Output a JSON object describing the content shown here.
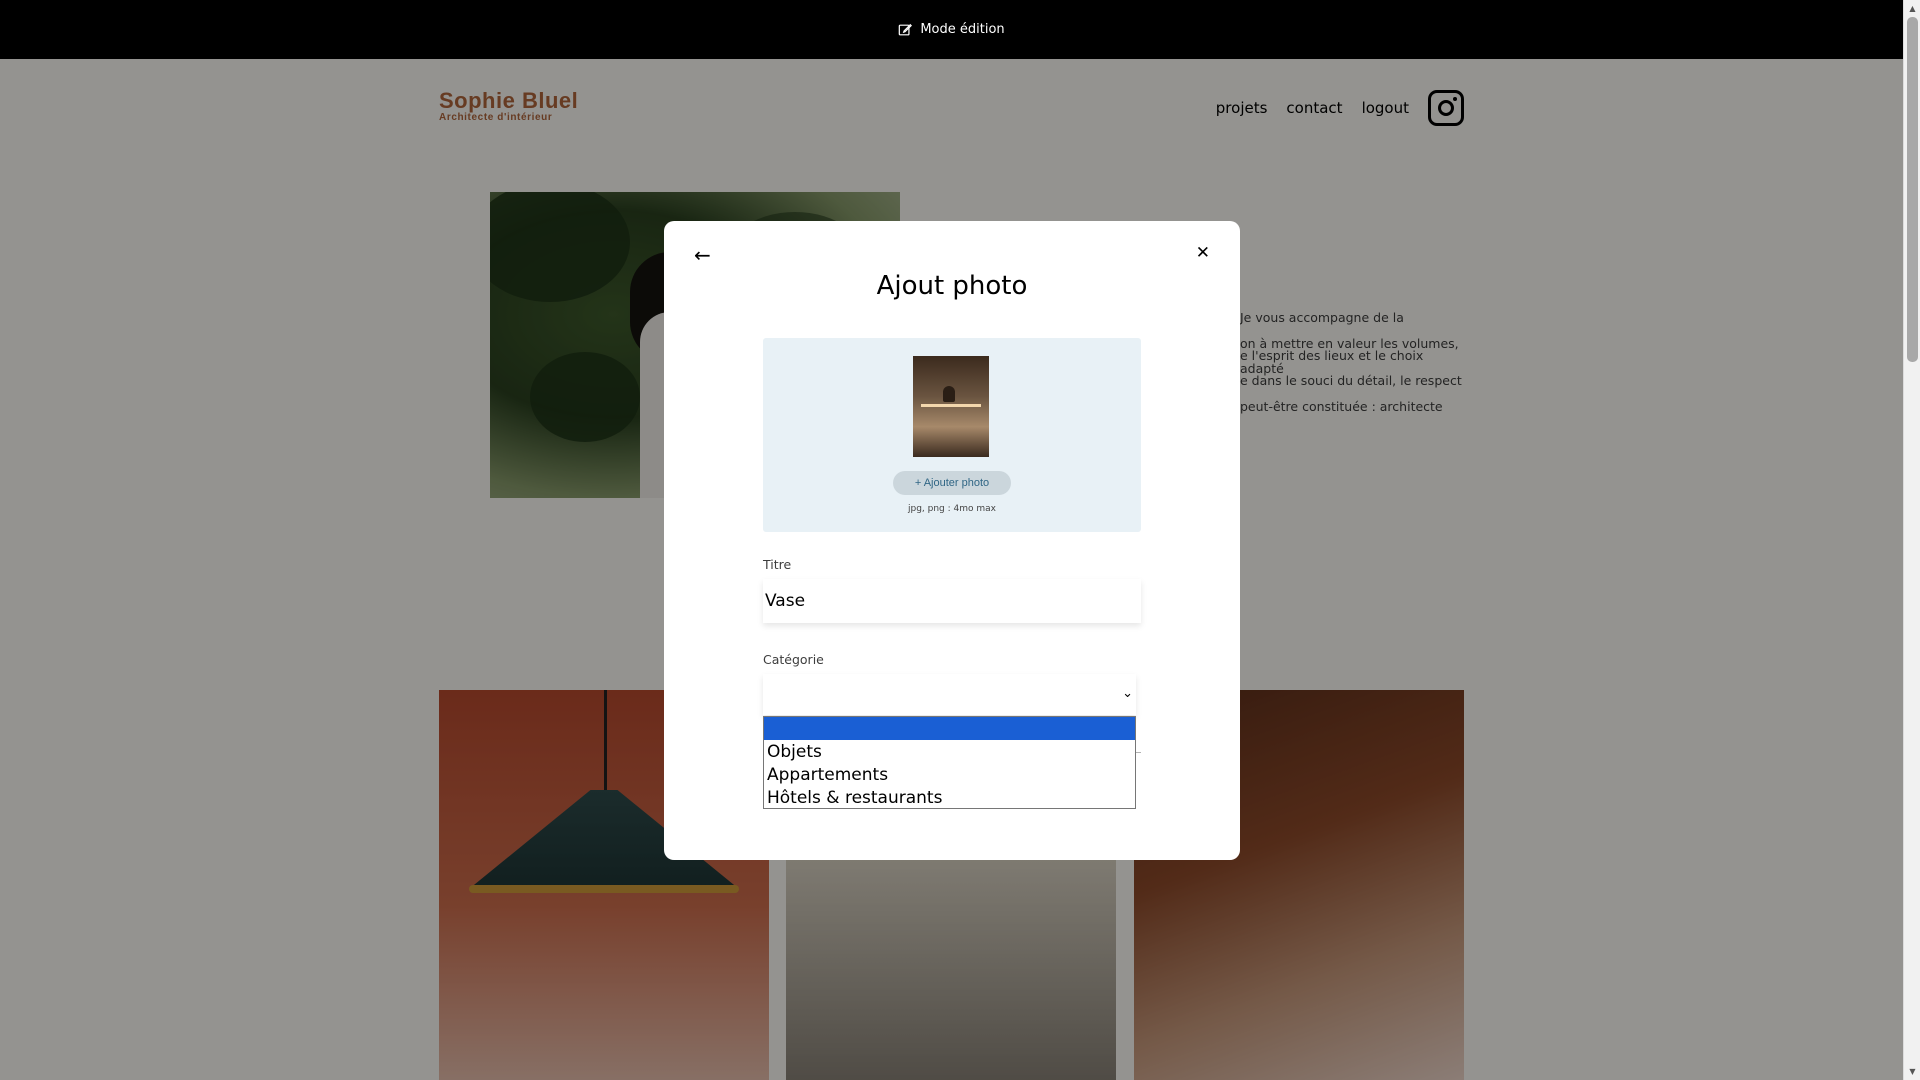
{
  "edit_bar": {
    "label": "Mode édition",
    "icon": "edit-icon"
  },
  "header": {
    "logo_name": "Sophie Bluel",
    "logo_subtitle": "Architecte d'intérieur",
    "nav": [
      "projets",
      "contact",
      "logout"
    ],
    "instagram_icon": "instagram-icon"
  },
  "intro": {
    "text_lines": [
      "Je vous accompagne de la",
      "on à mettre en valeur les volumes,",
      "e l'esprit des lieux et le choix adapté",
      "e dans le souci du détail, le respect",
      "peut-être constituée : architecte"
    ]
  },
  "modal": {
    "title": "Ajout photo",
    "back_icon": "arrow-left-icon",
    "close_icon": "close-icon",
    "upload": {
      "button_label": "+ Ajouter photo",
      "hint": "jpg, png : 4mo max"
    },
    "title_field": {
      "label": "Titre",
      "value": "Vase"
    },
    "category_field": {
      "label": "Catégorie",
      "selected": "",
      "options": [
        "",
        "Objets",
        "Appartements",
        "Hôtels & restaurants"
      ]
    }
  },
  "colors": {
    "brand": "#b1663c",
    "validate": "#1d6154",
    "upload_bg": "#e8f1f6",
    "option_highlight": "#1a5fd4"
  }
}
